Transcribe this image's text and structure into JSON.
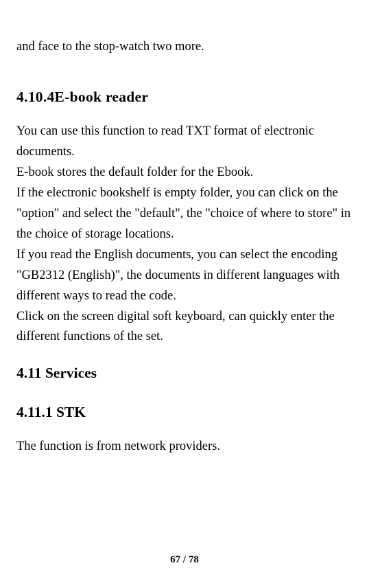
{
  "fragment_top": "and face to the stop-watch two more.",
  "section_4_10_4": {
    "heading": "4.10.4E-book reader",
    "p1": "You can use this function to read TXT format of electronic documents.",
    "p2": "E-book stores the default folder for the Ebook.",
    "p3": "If the electronic bookshelf is empty folder, you can click on the \"option\" and select the \"default\", the \"choice of where to store\" in the choice of storage locations.",
    "p4": "If you read the English documents, you can select the encoding \"GB2312 (English)\", the documents in different languages with different ways to read the code.",
    "p5": "Click on the screen digital soft keyboard, can quickly enter the different functions of the set."
  },
  "section_4_11": {
    "heading": "4.11 Services"
  },
  "section_4_11_1": {
    "heading": "4.11.1 STK",
    "p1": "The function is from network providers."
  },
  "page_footer": "67 / 78"
}
